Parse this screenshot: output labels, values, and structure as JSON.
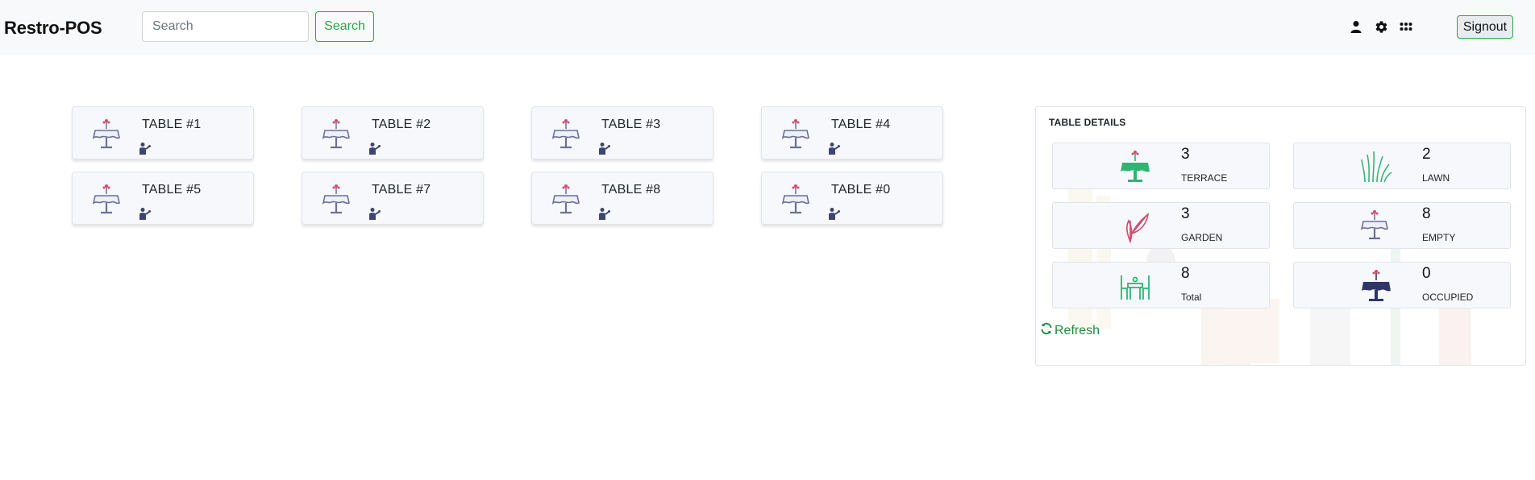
{
  "navbar": {
    "brand": "Restro-POS",
    "search_placeholder": "Search",
    "search_label": "Search",
    "signout_label": "Signout",
    "icons": [
      "user-icon",
      "gear-icon",
      "apps-grid-icon"
    ]
  },
  "tables": [
    {
      "name": "TABLE #1"
    },
    {
      "name": "TABLE #2"
    },
    {
      "name": "TABLE #3"
    },
    {
      "name": "TABLE #4"
    },
    {
      "name": "TABLE #5"
    },
    {
      "name": "TABLE #7"
    },
    {
      "name": "TABLE #8"
    },
    {
      "name": "TABLE #0"
    }
  ],
  "details": {
    "title": "TABLE DETAILS",
    "stats": [
      {
        "value": "3",
        "label": "TERRACE",
        "icon": "terrace-table-icon",
        "color": "#2bb673"
      },
      {
        "value": "2",
        "label": "LAWN",
        "icon": "grass-icon",
        "color": "#3bb37a"
      },
      {
        "value": "3",
        "label": "GARDEN",
        "icon": "garden-leaf-icon",
        "color": "#d24b6b"
      },
      {
        "value": "8",
        "label": "EMPTY",
        "icon": "empty-table-icon",
        "color": "#6b6f9a"
      },
      {
        "value": "8",
        "label": "Total",
        "icon": "dining-set-icon",
        "color": "#2bb673"
      },
      {
        "value": "0",
        "label": "OCCUPIED",
        "icon": "occupied-table-icon",
        "color": "#2f3566"
      }
    ],
    "refresh_label": "Refresh"
  },
  "colors": {
    "accent": "#28a745",
    "navbar_bg": "#f8f9fa",
    "card_bg": "#f6f8fb"
  }
}
